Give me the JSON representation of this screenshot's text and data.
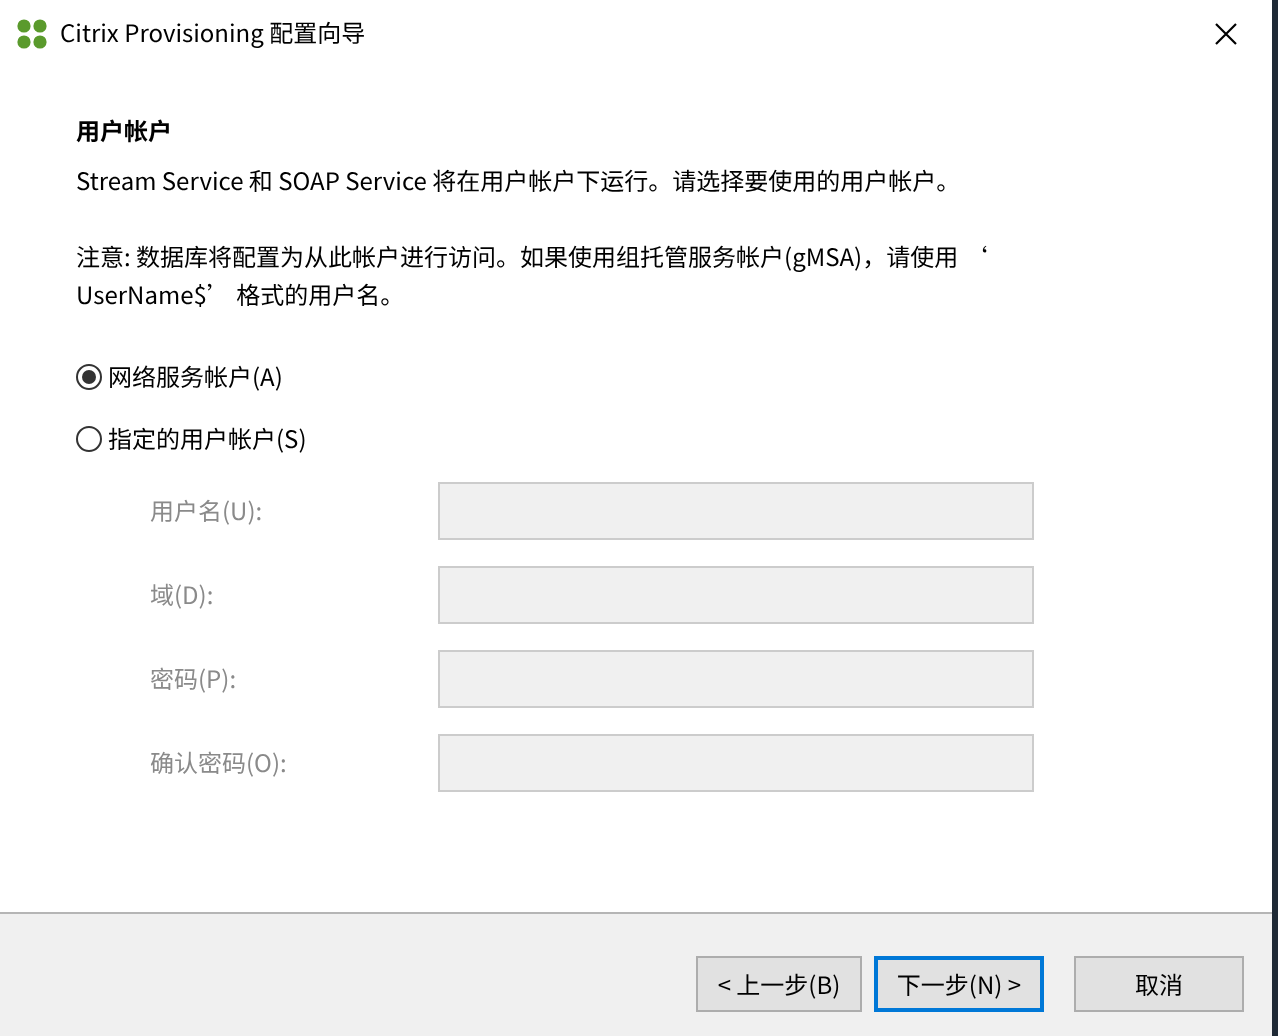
{
  "window": {
    "title": "Citrix Provisioning 配置向导"
  },
  "heading": "用户帐户",
  "description": "Stream Service 和 SOAP Service 将在用户帐户下运行。请选择要使用的用户帐户。",
  "note": "注意: 数据库将配置为从此帐户进行访问。如果使用组托管服务帐户(gMSA)，请使用 ‘ UserName$’ 格式的用户名。",
  "account_options": [
    {
      "label": "网络服务帐户(A)",
      "selected": true
    },
    {
      "label": "指定的用户帐户(S)",
      "selected": false
    }
  ],
  "fields": [
    {
      "label": "用户名(U):",
      "disabled": true
    },
    {
      "label": "域(D):",
      "disabled": true
    },
    {
      "label": "密码(P):",
      "disabled": true
    },
    {
      "label": "确认密码(O):",
      "disabled": true
    }
  ],
  "buttons": [
    {
      "label": "< 上一步(B)",
      "default": false
    },
    {
      "label": "下一步(N) >",
      "default": true
    },
    {
      "label": "取消",
      "default": false
    }
  ]
}
